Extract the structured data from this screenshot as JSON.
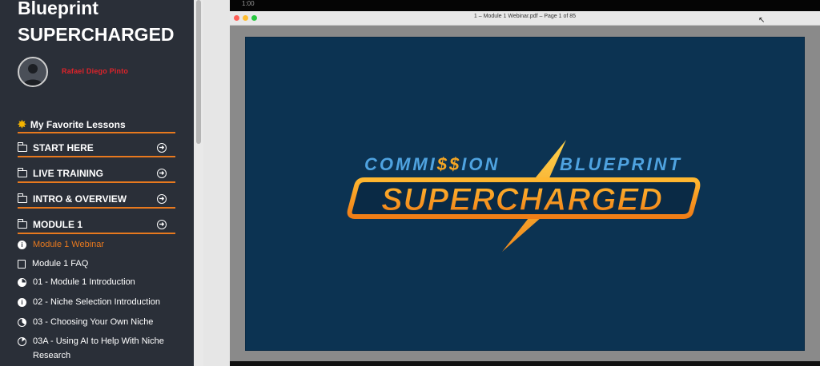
{
  "sidebar": {
    "course_title_line1": "Blueprint",
    "course_title_line2": "SUPERCHARGED",
    "username": "Rafael Diego Pinto",
    "favorites_label": "My Favorite Lessons",
    "sections": [
      {
        "label": "START HERE"
      },
      {
        "label": "LIVE TRAINING"
      },
      {
        "label": "INTRO & OVERVIEW"
      },
      {
        "label": "MODULE 1"
      }
    ],
    "lessons": [
      {
        "label": "Module 1 Webinar",
        "active": true
      },
      {
        "label": "Module 1 FAQ"
      },
      {
        "label": "01 - Module 1 Introduction"
      },
      {
        "label": "02 - Niche Selection Introduction"
      },
      {
        "label": "03 - Choosing Your Own Niche"
      },
      {
        "label": "03A - Using AI to Help With Niche Research"
      }
    ]
  },
  "video": {
    "timestamp": "1:00",
    "window_title": "1 – Module 1 Webinar.pdf – Page 1 of 85",
    "logo_top_left": "COMMI",
    "logo_dollars": "$$",
    "logo_top_mid": "ION",
    "logo_top_right": "BLUEPRINT",
    "logo_main": "SUPERCHARGED"
  },
  "colors": {
    "sidebar_bg": "#2a2f38",
    "accent_orange": "#e8791e",
    "slide_bg": "#0c3352",
    "logo_blue": "#4fa3e0",
    "logo_gold": "#f5a623"
  }
}
